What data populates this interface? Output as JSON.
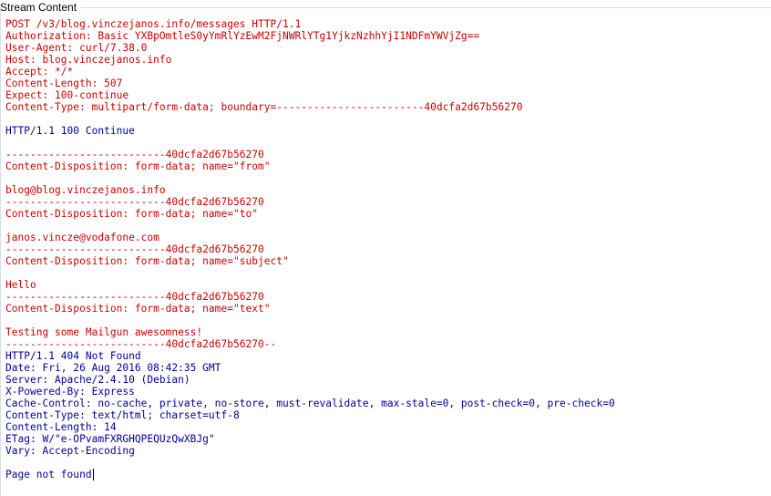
{
  "window": {
    "title": "Stream Content"
  },
  "colors": {
    "client": "#cc0000",
    "server": "#000099"
  },
  "stream": {
    "lines": [
      {
        "text": "POST /v3/blog.vinczejanos.info/messages HTTP/1.1",
        "from": "client"
      },
      {
        "text": "Authorization: Basic YXBpOmtleS0yYmRlYzEwM2FjNWRlYTg1YjkzNzhhYjI1NDFmYWVjZg==",
        "from": "client"
      },
      {
        "text": "User-Agent: curl/7.38.0",
        "from": "client"
      },
      {
        "text": "Host: blog.vinczejanos.info",
        "from": "client"
      },
      {
        "text": "Accept: */*",
        "from": "client"
      },
      {
        "text": "Content-Length: 507",
        "from": "client"
      },
      {
        "text": "Expect: 100-continue",
        "from": "client"
      },
      {
        "text": "Content-Type: multipart/form-data; boundary=------------------------40dcfa2d67b56270",
        "from": "client"
      },
      {
        "text": "",
        "from": "client"
      },
      {
        "text": "HTTP/1.1 100 Continue",
        "from": "server"
      },
      {
        "text": "",
        "from": "server"
      },
      {
        "text": "--------------------------40dcfa2d67b56270",
        "from": "client"
      },
      {
        "text": "Content-Disposition: form-data; name=\"from\"",
        "from": "client"
      },
      {
        "text": "",
        "from": "client"
      },
      {
        "text": "blog@blog.vinczejanos.info",
        "from": "client"
      },
      {
        "text": "--------------------------40dcfa2d67b56270",
        "from": "client"
      },
      {
        "text": "Content-Disposition: form-data; name=\"to\"",
        "from": "client"
      },
      {
        "text": "",
        "from": "client"
      },
      {
        "text": "janos.vincze@vodafone.com",
        "from": "client"
      },
      {
        "text": "--------------------------40dcfa2d67b56270",
        "from": "client"
      },
      {
        "text": "Content-Disposition: form-data; name=\"subject\"",
        "from": "client"
      },
      {
        "text": "",
        "from": "client"
      },
      {
        "text": "Hello",
        "from": "client"
      },
      {
        "text": "--------------------------40dcfa2d67b56270",
        "from": "client"
      },
      {
        "text": "Content-Disposition: form-data; name=\"text\"",
        "from": "client"
      },
      {
        "text": "",
        "from": "client"
      },
      {
        "text": "Testing some Mailgun awesomness!",
        "from": "client"
      },
      {
        "text": "--------------------------40dcfa2d67b56270--",
        "from": "client"
      },
      {
        "text": "HTTP/1.1 404 Not Found",
        "from": "server"
      },
      {
        "text": "Date: Fri, 26 Aug 2016 08:42:35 GMT",
        "from": "server"
      },
      {
        "text": "Server: Apache/2.4.10 (Debian)",
        "from": "server"
      },
      {
        "text": "X-Powered-By: Express",
        "from": "server"
      },
      {
        "text": "Cache-Control: no-cache, private, no-store, must-revalidate, max-stale=0, post-check=0, pre-check=0",
        "from": "server"
      },
      {
        "text": "Content-Type: text/html; charset=utf-8",
        "from": "server"
      },
      {
        "text": "Content-Length: 14",
        "from": "server"
      },
      {
        "text": "ETag: W/\"e-OPvamFXRGHQPEQUzQwXBJg\"",
        "from": "server"
      },
      {
        "text": "Vary: Accept-Encoding",
        "from": "server"
      },
      {
        "text": "",
        "from": "server"
      },
      {
        "text": "Page not found",
        "from": "server",
        "caret": true
      }
    ]
  }
}
